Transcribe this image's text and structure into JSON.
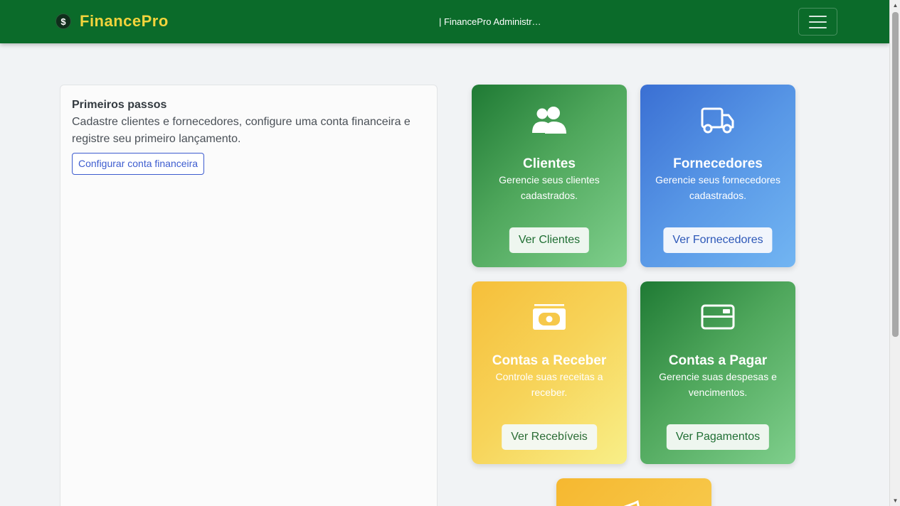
{
  "navbar": {
    "brand_icon": "$",
    "brand_name": "FinancePro",
    "subtitle": "| FinancePro Administr…",
    "menu_icon": "hamburger-menu-icon"
  },
  "getting_started": {
    "title": "Primeiros passos",
    "text": "Cadastre clientes e fornecedores, configure uma conta financeira e registre seu primeiro lançamento.",
    "button_label": "Configurar conta financeira"
  },
  "cards": [
    {
      "icon": "users-icon",
      "title": "Clientes",
      "description": "Gerencie seus clientes cadastrados.",
      "button": "Ver Clientes",
      "color": "#2e8b42"
    },
    {
      "icon": "truck-icon",
      "title": "Fornecedores",
      "description": "Gerencie seus fornecedores cadastrados.",
      "button": "Ver Fornecedores",
      "color": "#4a86e0"
    },
    {
      "icon": "money-bill-icon",
      "title": "Contas a Receber",
      "description": "Controle suas receitas a receber.",
      "button": "Ver Recebíveis",
      "color": "#f7cf4f"
    },
    {
      "icon": "credit-card-icon",
      "title": "Contas a Pagar",
      "description": "Gerencie suas despesas e vencimentos.",
      "button": "Ver Pagamentos",
      "color": "#2e8b42"
    }
  ],
  "colors": {
    "navbar": "#0b6b2a",
    "brand": "#f2d43c",
    "outline_button": "#3d5ccf"
  }
}
